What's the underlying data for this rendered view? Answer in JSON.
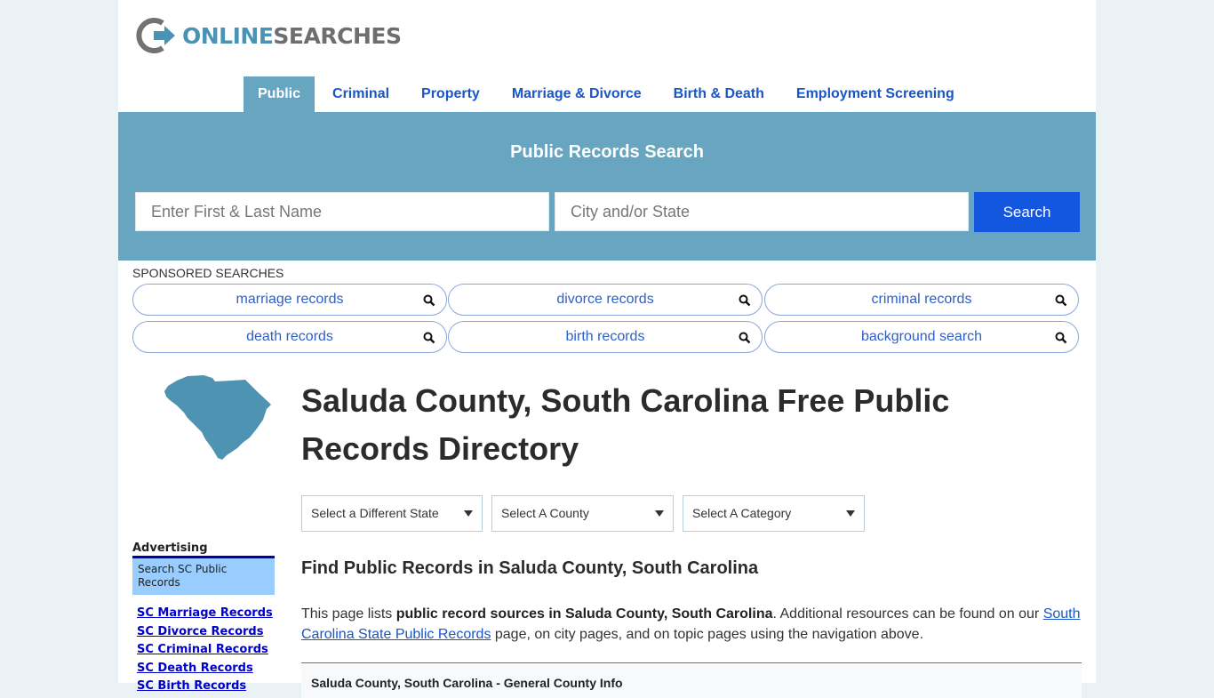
{
  "logo": {
    "part1": "ONLINE",
    "part2": "SEARCHES"
  },
  "nav": {
    "items": [
      {
        "label": "Public",
        "active": true
      },
      {
        "label": "Criminal"
      },
      {
        "label": "Property"
      },
      {
        "label": "Marriage & Divorce"
      },
      {
        "label": "Birth & Death"
      },
      {
        "label": "Employment Screening"
      }
    ]
  },
  "hero": {
    "title": "Public Records Search",
    "name_placeholder": "Enter First & Last Name",
    "location_placeholder": "City and/or State",
    "search_label": "Search"
  },
  "sponsored": {
    "label": "SPONSORED SEARCHES",
    "items": [
      "marriage records",
      "divorce records",
      "criminal records",
      "death records",
      "birth records",
      "background search"
    ]
  },
  "page": {
    "title": "Saluda County, South Carolina Free Public Records Directory",
    "state_icon": "south-carolina-map"
  },
  "selects": {
    "state": "Select a Different State",
    "county": "Select A County",
    "category": "Select A Category"
  },
  "sidebar": {
    "advertising_label": "Advertising",
    "ad_box": "Search SC Public Records",
    "links": [
      "SC Marriage Records",
      "SC Divorce Records",
      "SC Criminal Records",
      "SC Death Records",
      "SC Birth Records"
    ]
  },
  "content": {
    "heading": "Find Public Records in Saluda County, South Carolina",
    "intro_pre": "This page lists ",
    "intro_bold": "public record sources in Saluda County, South Carolina",
    "intro_mid": ". Additional resources can be found on our ",
    "intro_link": "South Carolina State Public Records",
    "intro_post": " page, on city pages, and on topic pages using the navigation above.",
    "info_box_title": "Saluda County, South Carolina - General County Info"
  },
  "colors": {
    "brand_blue": "#68a5c0",
    "nav_link": "#1a56c4",
    "search_button": "#1356e0",
    "map_fill": "#4f93b2",
    "ad_box": "#99ccff"
  }
}
